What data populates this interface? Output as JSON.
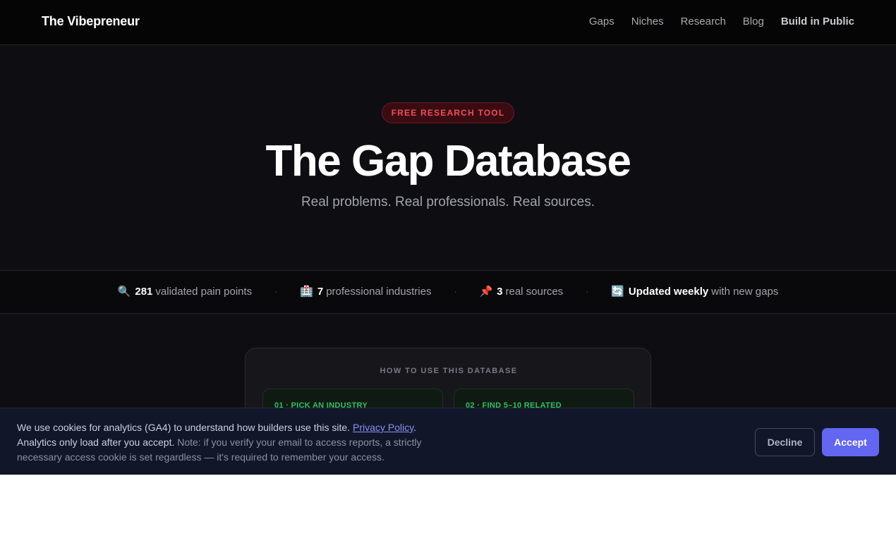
{
  "nav": {
    "brand": "The Vibepreneur",
    "links": [
      "Gaps",
      "Niches",
      "Research",
      "Blog",
      "Build in Public"
    ]
  },
  "hero": {
    "badge": "FREE RESEARCH TOOL",
    "title": "The Gap Database",
    "subtitle": "Real problems. Real professionals. Real sources."
  },
  "stats": [
    {
      "icon": "magnifier-icon",
      "emoji": "🔍",
      "value": "281",
      "label": "validated pain points"
    },
    {
      "icon": "hospital-icon",
      "emoji": "🏥",
      "value": "7",
      "label": "professional industries"
    },
    {
      "icon": "pushpin-icon",
      "emoji": "📌",
      "value": "3",
      "label": "real sources"
    },
    {
      "icon": "refresh-icon",
      "emoji": "🔄",
      "value": "Updated weekly",
      "label": "with new gaps"
    }
  ],
  "stats_separator": "·",
  "howto": {
    "heading": "HOW TO USE THIS DATABASE",
    "steps": [
      "01 · PICK AN INDUSTRY",
      "02 · FIND 5–10 RELATED"
    ]
  },
  "cookie": {
    "text_before_link": "We use cookies for analytics (GA4) to understand how builders use this site. ",
    "link": "Privacy Policy",
    "text_after_link": ".",
    "line2": "Analytics only load after you accept.",
    "note": " Note: if you verify your email to access reports, a strictly necessary access cookie is set regardless — it's required to remember your access.",
    "decline": "Decline",
    "accept": "Accept"
  },
  "colors": {
    "background": "#0e0e12",
    "header": "#050505",
    "badge_text": "#ef4e5a",
    "step_text": "#2fbf62",
    "accept_button": "#6366f1",
    "link": "#8b8ff7"
  }
}
